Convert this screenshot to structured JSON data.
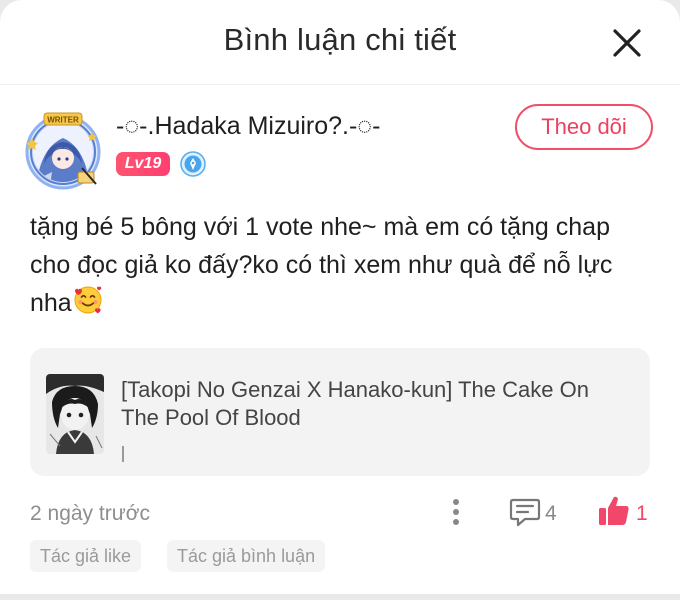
{
  "header": {
    "title": "Bình luận chi tiết",
    "close_icon": "close-icon"
  },
  "user": {
    "name": "-◌-.Hadaka Mizuiro?.-◌-",
    "level": "Lv19",
    "avatar_frame_text": "WRITER",
    "verified_icon": "verified-badge-icon"
  },
  "follow_button": {
    "label": "Theo dõi",
    "color": "#ef3f60"
  },
  "comment": {
    "text": "tặng bé 5 bông với 1 vote nhe~ mà em có tặng chap cho đọc giả ko đấy?ko có thì xem như quà để nỗ lực nha",
    "emoji": "🥰"
  },
  "story": {
    "title": "[Takopi No Genzai X Hanako-kun] The Cake On The Pool Of Blood",
    "cursor": "|"
  },
  "footer": {
    "time": "2 ngày trước",
    "comment_count": "4",
    "like_count": "1",
    "like_color": "#f0476a"
  },
  "tags": [
    {
      "label": "Tác giả like"
    },
    {
      "label": "Tác giả bình luận"
    }
  ]
}
